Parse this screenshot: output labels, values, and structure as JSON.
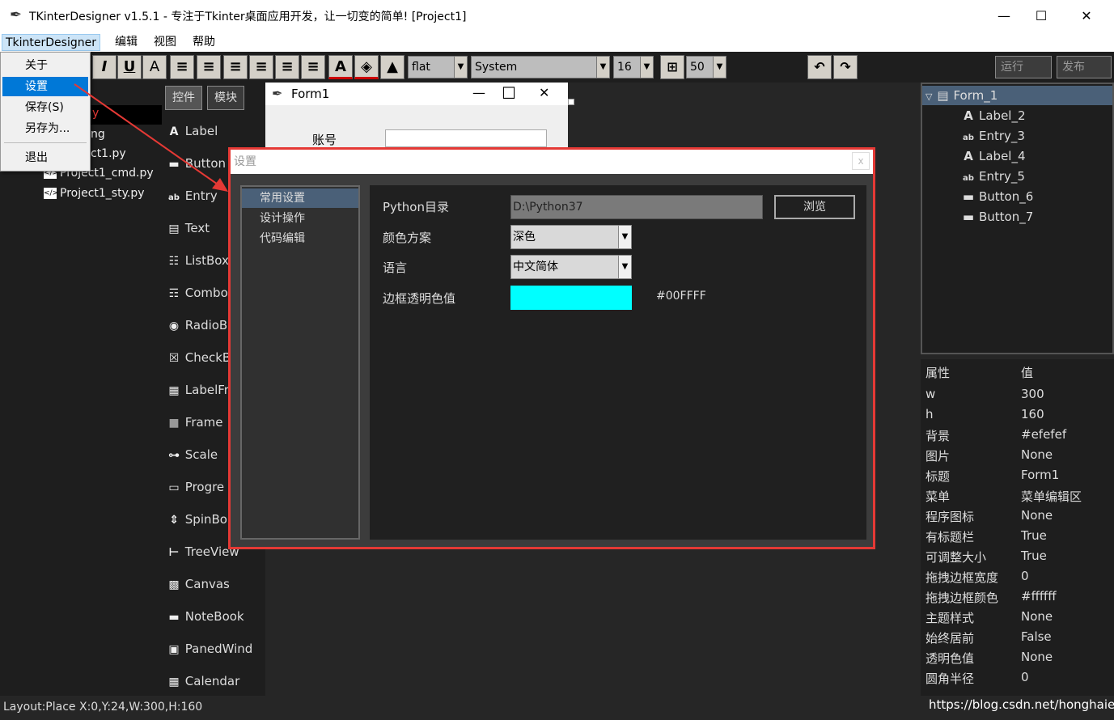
{
  "window": {
    "title": "TKinterDesigner v1.5.1 - 专注于Tkinter桌面应用开发，让一切变的简单!   [Project1]",
    "min": "—",
    "max": "☐",
    "close": "✕"
  },
  "menubar": [
    "TkinterDesigner",
    "编辑",
    "视图",
    "帮助"
  ],
  "dropdown": {
    "items": [
      "关于",
      "设置",
      "保存(S)",
      "另存为...",
      "退出"
    ]
  },
  "toolbar": {
    "buttons": [
      "I",
      "U",
      "A",
      "≡",
      "≡",
      "≡",
      "≡",
      "≡",
      "≡",
      "A"
    ],
    "relief": "flat",
    "font": "System",
    "size": "16",
    "grid": "50",
    "run": "运行",
    "publish": "发布"
  },
  "left_files": [
    "Project1_cmd.py",
    "Project1_sty.py"
  ],
  "left_files_partial": [
    "y",
    "ng",
    "ct1.py"
  ],
  "tabs": [
    "控件",
    "模块"
  ],
  "widgets": [
    "Label",
    "Button",
    "Entry",
    "Text",
    "ListBox",
    "Combo",
    "RadioB",
    "CheckB",
    "LabelFr",
    "Frame",
    "Scale",
    "Progre",
    "SpinBo",
    "TreeView",
    "Canvas",
    "NoteBook",
    "PanedWind",
    "Calendar"
  ],
  "form1": {
    "title": "Form1",
    "label": "账号",
    "min": "—",
    "max": "☐",
    "close": "✕"
  },
  "dialog": {
    "title": "设置",
    "close": "x",
    "sidebar": [
      "常用设置",
      "设计操作",
      "代码编辑"
    ],
    "python_dir_label": "Python目录",
    "python_dir": "D:\\Python37",
    "browse": "浏览",
    "scheme_label": "颜色方案",
    "scheme": "深色",
    "lang_label": "语言",
    "lang": "中文简体",
    "trans_label": "边框透明色值",
    "trans_value": "#00FFFF",
    "trans_color": "#00FFFF"
  },
  "tree": {
    "root": "Form_1",
    "children": [
      "Label_2",
      "Entry_3",
      "Label_4",
      "Entry_5",
      "Button_6",
      "Button_7"
    ]
  },
  "props": {
    "header": [
      "属性",
      "值"
    ],
    "rows": [
      [
        "w",
        "300"
      ],
      [
        "h",
        "160"
      ],
      [
        "背景",
        "#efefef"
      ],
      [
        "图片",
        "None"
      ],
      [
        "标题",
        "Form1"
      ],
      [
        "菜单",
        "菜单编辑区"
      ],
      [
        "程序图标",
        "None"
      ],
      [
        "有标题栏",
        "True"
      ],
      [
        "可调整大小",
        "True"
      ],
      [
        "拖拽边框宽度",
        "0"
      ],
      [
        "拖拽边框颜色",
        "#ffffff"
      ],
      [
        "主题样式",
        "None"
      ],
      [
        "始终居前",
        "False"
      ],
      [
        "透明色值",
        "None"
      ],
      [
        "圆角半径",
        "0"
      ]
    ]
  },
  "status": {
    "left": "Layout:Place  X:0,Y:24,W:300,H:160",
    "right": "https://blog.csdn.net/honghaier"
  }
}
